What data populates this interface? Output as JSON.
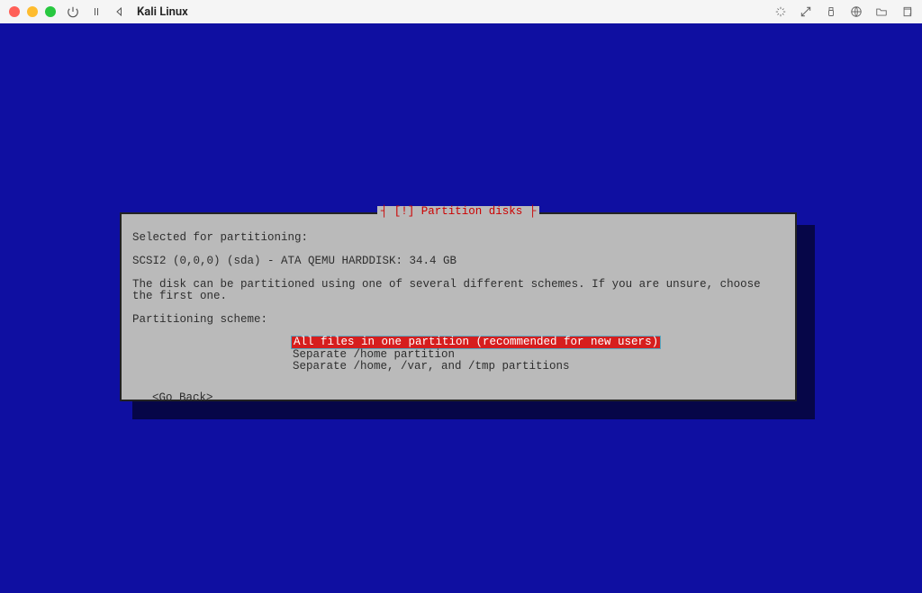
{
  "titlebar": {
    "app_name": "Kali Linux"
  },
  "dialog": {
    "title": "┤ [!] Partition disks ├",
    "line_selected": "Selected for partitioning:",
    "line_disk": "SCSI2 (0,0,0) (sda) - ATA QEMU HARDDISK: 34.4 GB",
    "line_guide": "The disk can be partitioned using one of several different schemes. If you are unsure, choose the first one.",
    "line_label": "Partitioning scheme:",
    "schemes": [
      "All files in one partition (recommended for new users)",
      "Separate /home partition",
      "Separate /home, /var, and /tmp partitions"
    ],
    "go_back": "<Go Back>"
  }
}
